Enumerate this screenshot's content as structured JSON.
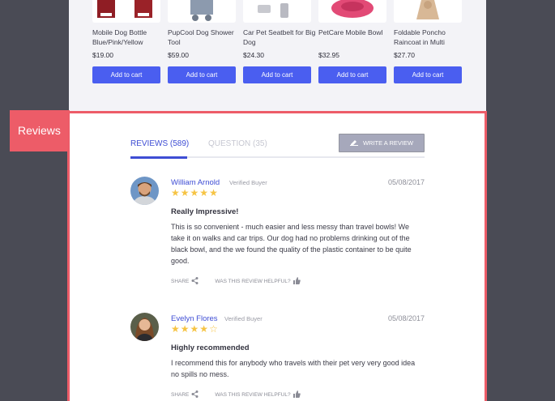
{
  "products": [
    {
      "name": "Mobile Dog Bottle Blue/Pink/Yellow",
      "price": "$19.00",
      "button": "Add to cart"
    },
    {
      "name": "PupCool Dog Shower Tool",
      "price": "$59.00",
      "button": "Add to cart"
    },
    {
      "name": "Car Pet Seatbelt for Big Dog",
      "price": "$24.30",
      "button": "Add to cart"
    },
    {
      "name": "PetCare Mobile Bowl",
      "price": "$32.95",
      "button": "Add to cart"
    },
    {
      "name": "Foldable Poncho Raincoat in Multi",
      "price": "$27.70",
      "button": "Add to cart"
    }
  ],
  "callout": {
    "label": "Reviews"
  },
  "tabs": {
    "reviews": "REVIEWS (589)",
    "questions": "QUESTION (35)"
  },
  "write_review": {
    "label": "WRITE A REVIEW"
  },
  "reviews": [
    {
      "author": "William Arnold",
      "verified": "Verified Buyer",
      "date": "05/08/2017",
      "rating": 5,
      "title": "Really Impressive!",
      "text": "This is so convenient - much easier and less messy than travel bowls! We take it on walks and car trips. Our dog had no problems drinking out of the black bowl, and the we found the quality of the plastic container to be quite good.",
      "share": "SHARE",
      "helpful": "WAS THIS REVIEW HELPFUL?"
    },
    {
      "author": "Evelyn Flores",
      "verified": "Verified Buyer",
      "date": "05/08/2017",
      "rating": 4,
      "title": "Highly recommended",
      "text": "I recommend this for anybody who travels with their pet very very good idea no spills no mess.",
      "share": "SHARE",
      "helpful": "WAS THIS REVIEW HELPFUL?"
    }
  ],
  "colors": {
    "accent": "#3e4dd4",
    "button": "#4a5ef0",
    "highlight": "#ed5c68",
    "star": "#f6c444"
  }
}
